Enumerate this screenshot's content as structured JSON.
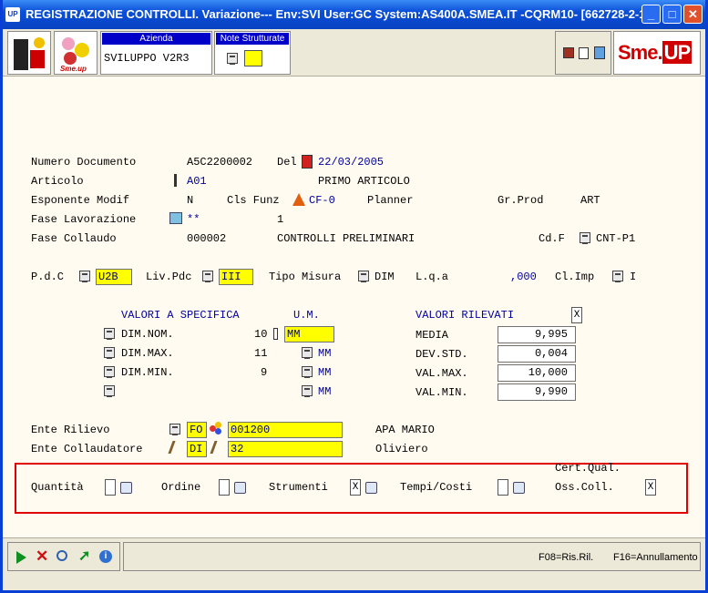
{
  "window": {
    "title": "REGISTRAZIONE CONTROLLI.  Variazione--- Env:SVI User:GC System:AS400A.SMEA.IT -CQRM10- [662728-2-1]",
    "app_icon": "UP",
    "buttons": [
      "_",
      "□",
      "✕"
    ]
  },
  "toolbar": {
    "azienda_label": "Azienda",
    "azienda_value": "SVILUPPO V2R3",
    "note_label": "Note Strutturate",
    "logo_small": "Sme.up",
    "logo": "Sme.UP",
    "logo_sme": "Sme.",
    "logo_up": "UP"
  },
  "form": {
    "numero_documento": {
      "label": "Numero Documento",
      "value": "A5C2200002",
      "del_label": "Del",
      "date": "22/03/2005"
    },
    "articolo": {
      "label": "Articolo",
      "code": "A01",
      "desc": "PRIMO ARTICOLO"
    },
    "esponente": {
      "label": "Esponente Modif",
      "value": "N",
      "cls_label": "Cls Funz",
      "cls_value": "CF-0",
      "planner_label": "Planner",
      "grprod_label": "Gr.Prod",
      "grprod_value": "ART"
    },
    "fase_lavorazione": {
      "label": "Fase Lavorazione",
      "value": "**",
      "num": "1"
    },
    "fase_collaudo": {
      "label": "Fase Collaudo",
      "value": "000002",
      "desc": "CONTROLLI PRELIMINARI",
      "cdf_label": "Cd.F",
      "cdf_value": "CNT-P1"
    },
    "pdc": {
      "label": "P.d.C",
      "value": "U2B",
      "livpdc_label": "Liv.Pdc",
      "livpdc_value": "III",
      "tipo_label": "Tipo Misura",
      "tipo_value": "DIM",
      "lqa_label": "L.q.a",
      "lqa_value": ",000",
      "climp_label": "Cl.Imp",
      "climp_value": "I"
    },
    "specifica": {
      "header": "VALORI A SPECIFICA",
      "um_header": "U.M.",
      "rows": [
        {
          "label": "DIM.NOM.",
          "value": "10",
          "um": "MM"
        },
        {
          "label": "DIM.MAX.",
          "value": "11",
          "um": "MM"
        },
        {
          "label": "DIM.MIN.",
          "value": "9",
          "um": "MM"
        },
        {
          "label": "",
          "value": "",
          "um": "MM"
        }
      ]
    },
    "rilevati": {
      "header": "VALORI RILEVATI",
      "check": "X",
      "rows": [
        {
          "label": "MEDIA",
          "value": "9,995"
        },
        {
          "label": "DEV.STD.",
          "value": "0,004"
        },
        {
          "label": "VAL.MAX.",
          "value": "10,000"
        },
        {
          "label": "VAL.MIN.",
          "value": "9,990"
        }
      ]
    },
    "ente_rilievo": {
      "label": "Ente Rilievo",
      "type": "FO",
      "code": "001200",
      "name": "APA MARIO"
    },
    "ente_collaudatore": {
      "label": "Ente Collaudatore",
      "type": "DI",
      "code": "32",
      "name": "Oliviero"
    },
    "flags": {
      "quantita": "Quantità",
      "ordine": "Ordine",
      "strumenti": "Strumenti",
      "strumenti_value": "X",
      "tempi": "Tempi/Costi",
      "cert": "Cert.Qual.",
      "oss": "Oss.Coll.",
      "oss_value": "X"
    }
  },
  "status": {
    "f08": "F08=Ris.Ril.",
    "f16": "F16=Annullamento"
  }
}
